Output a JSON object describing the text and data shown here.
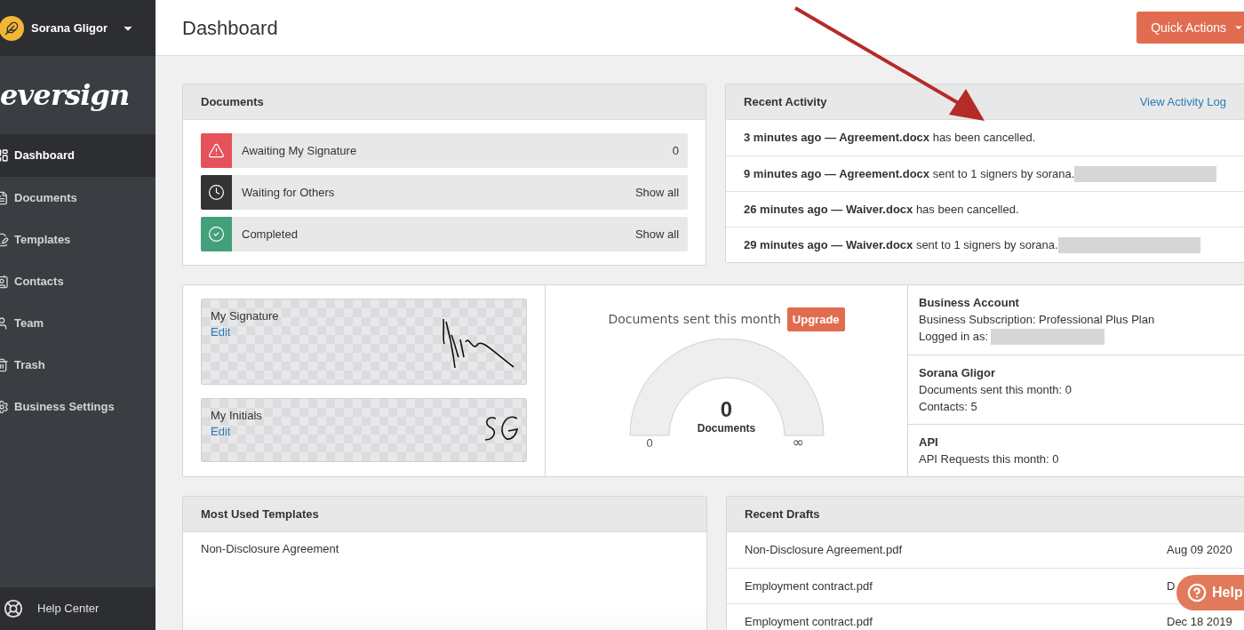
{
  "user": {
    "name": "Sorana Gligor"
  },
  "logo": "eversign",
  "sidebar": {
    "items": [
      {
        "label": "Dashboard",
        "selected": true
      },
      {
        "label": "Documents",
        "selected": false
      },
      {
        "label": "Templates",
        "selected": false
      },
      {
        "label": "Contacts",
        "selected": false
      },
      {
        "label": "Team",
        "selected": false
      },
      {
        "label": "Trash",
        "selected": false
      },
      {
        "label": "Business Settings",
        "selected": false
      }
    ],
    "help": "Help Center"
  },
  "header": {
    "title": "Dashboard",
    "action": "Quick Actions"
  },
  "documents": {
    "title": "Documents",
    "rows": [
      {
        "label": "Awaiting My Signature",
        "value": "0",
        "kind": "warning"
      },
      {
        "label": "Waiting for Others",
        "value": "Show all",
        "kind": "clock"
      },
      {
        "label": "Completed",
        "value": "Show all",
        "kind": "done"
      }
    ]
  },
  "activity": {
    "title": "Recent Activity",
    "link": "View Activity Log",
    "rows": [
      {
        "text": "**3 minutes ago — Agreement.docx** has been cancelled.",
        "redacted": false
      },
      {
        "text": "**9 minutes ago — Agreement.docx** sent to 1 signers by sorana.",
        "redacted": true
      },
      {
        "text": "**26 minutes ago — Waiver.docx** has been cancelled.",
        "redacted": false
      },
      {
        "text": "**29 minutes ago — Waiver.docx** sent to 1 signers by sorana.",
        "redacted": true
      }
    ]
  },
  "signatures": [
    {
      "label": "My Signature",
      "action": "Edit",
      "kind": "signature"
    },
    {
      "label": "My Initials",
      "action": "Edit",
      "kind": "initials"
    }
  ],
  "usage": {
    "title": "Documents sent this month",
    "badge": "Upgrade",
    "count": "0",
    "unit": "Documents",
    "min": "0",
    "max": "∞"
  },
  "account": [
    {
      "title": "Business Account",
      "lines": [
        {
          "text": "Business Subscription: Professional Plus Plan",
          "redacted": false
        },
        {
          "text": "Logged in as:",
          "redacted": true
        }
      ]
    },
    {
      "title": "Sorana Gligor",
      "lines": [
        {
          "text": "Documents sent this month: 0",
          "redacted": false
        },
        {
          "text": "Contacts: 5",
          "redacted": false
        }
      ]
    },
    {
      "title": "API",
      "lines": [
        {
          "text": "API Requests this month: 0",
          "redacted": false
        }
      ]
    }
  ],
  "templates": {
    "title": "Most Used Templates",
    "rows": [
      "Non-Disclosure Agreement"
    ]
  },
  "drafts": {
    "title": "Recent Drafts",
    "rows": [
      {
        "name": "Non-Disclosure Agreement.pdf",
        "date": "Aug 09 2020"
      },
      {
        "name": "Employment contract.pdf",
        "date": "D"
      },
      {
        "name": "Employment contract.pdf",
        "date": "Dec 18 2019"
      }
    ]
  },
  "help_button": "Help"
}
